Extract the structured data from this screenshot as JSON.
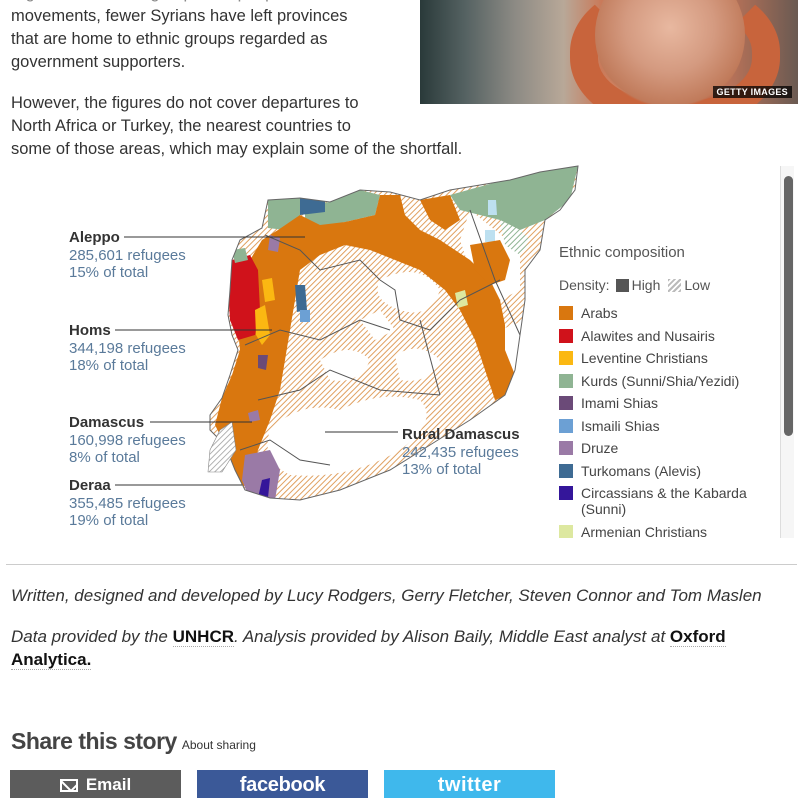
{
  "article": {
    "paragraph1_lines": [
      "regions and ethnic groups and people's",
      "movements, fewer Syrians have left provinces",
      "that are home to ethnic groups regarded as",
      "government supporters."
    ],
    "paragraph2_lines": [
      "However, the figures do not cover departures to",
      "North Africa or Turkey, the nearest countries to",
      "some of those areas, which may explain some of the shortfall."
    ]
  },
  "photo": {
    "description": "Crying child in orange headscarf",
    "credit": "GETTY IMAGES"
  },
  "map": {
    "callouts": [
      {
        "name": "Aleppo",
        "refugees": "285,601 refugees",
        "share": "15% of total"
      },
      {
        "name": "Homs",
        "refugees": "344,198 refugees",
        "share": "18% of total"
      },
      {
        "name": "Damascus",
        "refugees": "160,998 refugees",
        "share": "8% of total"
      },
      {
        "name": "Deraa",
        "refugees": "355,485 refugees",
        "share": "19% of total"
      },
      {
        "name": "Rural Damascus",
        "refugees": "242,435 refugees",
        "share": "13% of total"
      }
    ],
    "legend": {
      "title": "Ethnic composition",
      "density_label": "Density:",
      "density_high": "High",
      "density_low": "Low",
      "items": [
        {
          "label": "Arabs",
          "color": "#d9770f"
        },
        {
          "label": "Alawites and Nusairis",
          "color": "#d0121b"
        },
        {
          "label": "Leventine Christians",
          "color": "#fbb812"
        },
        {
          "label": "Kurds (Sunni/Shia/Yezidi)",
          "color": "#8fb493"
        },
        {
          "label": "Imami Shias",
          "color": "#6b4a78"
        },
        {
          "label": "Ismaili Shias",
          "color": "#6ca0d4"
        },
        {
          "label": "Druze",
          "color": "#9a7aa6"
        },
        {
          "label": "Turkomans (Alevis)",
          "color": "#3e6b93"
        },
        {
          "label": "Circassians & the Kabarda (Sunni)",
          "color": "#34169a"
        },
        {
          "label": "Armenian Christians",
          "color": "#dde8a0"
        }
      ]
    }
  },
  "credits": {
    "written_by": "Written, designed and developed by Lucy Rodgers, Gerry Fletcher, Steven Connor and Tom Maslen",
    "data_prefix": "Data provided by the ",
    "data_link": "UNHCR",
    "analysis_text": ". Analysis provided by Alison Baily, Middle East analyst at ",
    "analysis_link": "Oxford Analytica."
  },
  "share": {
    "title": "Share this story",
    "about": "About sharing",
    "buttons": [
      {
        "label": "Email",
        "color": "#5c5c5c"
      },
      {
        "label": "facebook",
        "color": "#3b5998"
      },
      {
        "label": "twitter",
        "color": "#3fb8ec"
      }
    ]
  }
}
